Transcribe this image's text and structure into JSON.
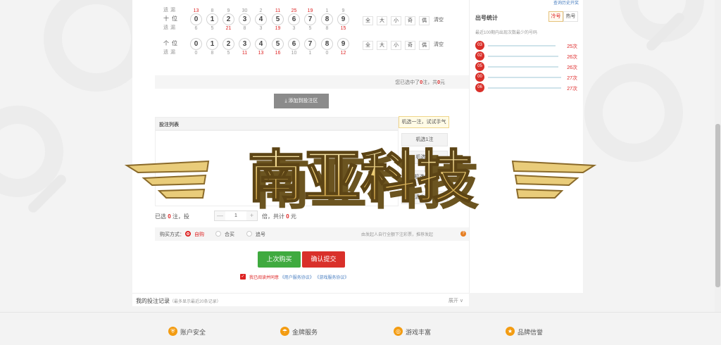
{
  "positions": [
    {
      "label": "",
      "miss_label": "遗漏",
      "numbers": [],
      "misses": [
        "13",
        "8",
        "9",
        "30",
        "2",
        "11",
        "25",
        "19",
        "1",
        "9"
      ],
      "hot": [
        true,
        false,
        false,
        false,
        false,
        true,
        true,
        true,
        false,
        false
      ]
    },
    {
      "label": "十位",
      "miss_label": "遗漏",
      "numbers": [
        "0",
        "1",
        "2",
        "3",
        "4",
        "5",
        "6",
        "7",
        "8",
        "9"
      ],
      "misses": [
        "6",
        "5",
        "21",
        "8",
        "3",
        "19",
        "3",
        "5",
        "8",
        "15"
      ],
      "hot": [
        false,
        false,
        true,
        false,
        false,
        true,
        false,
        false,
        false,
        true
      ]
    },
    {
      "label": "个位",
      "miss_label": "遗漏",
      "numbers": [
        "0",
        "1",
        "2",
        "3",
        "4",
        "5",
        "6",
        "7",
        "8",
        "9"
      ],
      "misses": [
        "0",
        "8",
        "5",
        "11",
        "13",
        "16",
        "10",
        "1",
        "0",
        "12"
      ],
      "hot": [
        false,
        false,
        false,
        true,
        true,
        true,
        false,
        false,
        false,
        true
      ]
    }
  ],
  "filters": [
    "全",
    "大",
    "小",
    "奇",
    "偶"
  ],
  "clear_label": "清空",
  "selection": {
    "prefix": "您已选中了",
    "count": "0",
    "mid": "注，共",
    "amount": "0",
    "suffix": "元"
  },
  "add_button": "添加到投注区",
  "bet_list": {
    "title": "投注列表",
    "tip": "机选一注，试试手气",
    "random_buttons": [
      "机选1注",
      "机选5注",
      "机选10注",
      "清空列表"
    ]
  },
  "quantity": {
    "selected_prefix": "已选",
    "selected_count": "0",
    "selected_unit": "注，投",
    "minus": "—",
    "value": "1",
    "plus": "+",
    "times": "倍，共计",
    "total": "0",
    "currency": "元"
  },
  "buy_mode": {
    "label": "购买方式：",
    "options": [
      "自购",
      "合买",
      "追号"
    ],
    "selected_index": 0,
    "note": "由发起人自行全额下注彩票，推荐发起"
  },
  "actions": {
    "last_buy": "上次购买",
    "submit": "确认提交"
  },
  "agreement": {
    "text": "我已阅读并同意",
    "link1": "《用户服务协议》",
    "link2": "《游戏服务协议》"
  },
  "records": {
    "title": "我的投注记录",
    "subtitle": "（最多显示最近20条记录）",
    "expand": "展开 ∨"
  },
  "sidebar": {
    "top_link": "查询历史开奖",
    "title": "出号统计",
    "tabs": [
      "冷号",
      "热号"
    ],
    "active_tab": 0,
    "desc": "最近100期内出现次数最少的号码",
    "hot": [
      {
        "ball": "03",
        "count": "25次",
        "ratio": 0.74
      },
      {
        "ball": "02",
        "count": "26次",
        "ratio": 0.77
      },
      {
        "ball": "05",
        "count": "26次",
        "ratio": 0.77
      },
      {
        "ball": "00",
        "count": "27次",
        "ratio": 0.8
      },
      {
        "ball": "06",
        "count": "27次",
        "ratio": 0.8
      }
    ]
  },
  "footer": [
    {
      "icon": "shield-icon",
      "label": "账户安全"
    },
    {
      "icon": "umbrella-icon",
      "label": "金牌服务"
    },
    {
      "icon": "gamepad-icon",
      "label": "游戏丰富"
    },
    {
      "icon": "trophy-icon",
      "label": "品牌信誉"
    }
  ],
  "watermark": "南亚科技",
  "colors": {
    "red": "#d9302a",
    "green": "#3faa3f",
    "gray_button": "#8b8b8b",
    "link": "#4a7fc1"
  }
}
